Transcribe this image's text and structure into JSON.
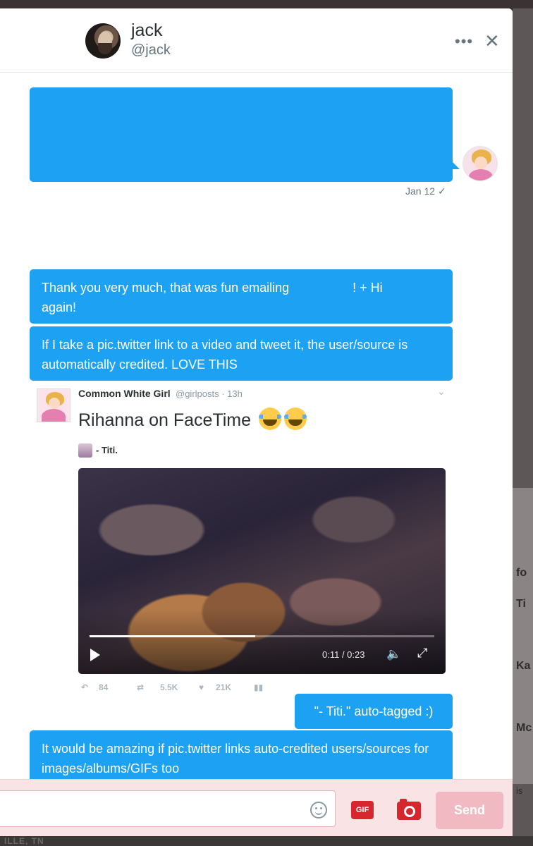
{
  "conversation": {
    "name": "jack",
    "handle": "@jack",
    "more_icon": "more-horizontal-icon",
    "close_icon": "close-icon"
  },
  "messages": {
    "first_date": "Jan 12",
    "thanks_part1": "Thank you very much, that was fun emailing ",
    "thanks_part2": "! + Hi",
    "thanks_line2": "again!",
    "link_text": "If I take a pic.twitter link to a video and tweet it, the user/source is automatically credited. LOVE THIS",
    "titi_text": "\"- Titi.\" auto-tagged :)",
    "amazing_text": "It would be amazing if pic.twitter links auto-credited users/sources for images/albums/GIFs too"
  },
  "tweet": {
    "author_name": "Common White Girl",
    "author_handle_time": "@girlposts · 13h",
    "text": "Rihanna on FaceTime",
    "emoji": "face-with-tears-of-joy",
    "tagged_user": "- Titi.",
    "video": {
      "time": "0:11 / 0:23",
      "progress": 0.48
    },
    "actions": {
      "replies": "84",
      "retweets": "5.5K",
      "likes": "21K"
    }
  },
  "composer": {
    "placeholder": "",
    "gif_label": "GIF",
    "send_label": "Send"
  },
  "background": {
    "right_fragments": [
      "fo",
      "Ti",
      "Ka",
      "Mc",
      "is"
    ],
    "bottom_fragment": "ILLE, TN"
  }
}
